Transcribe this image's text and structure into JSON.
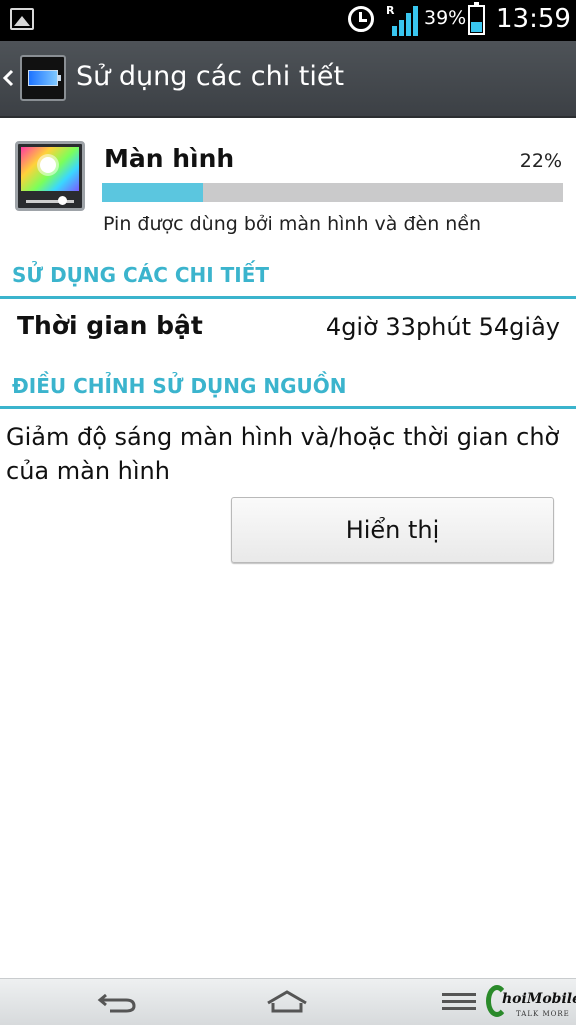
{
  "status_bar": {
    "battery_percent": "39%",
    "time": "13:59",
    "signal_label": "R",
    "battery_level": 0.39,
    "icons": [
      "gallery-icon",
      "alarm-icon",
      "signal-icon",
      "battery-icon"
    ],
    "accent_color": "#39c6ef"
  },
  "action_bar": {
    "title": "Sử dụng các chi tiết",
    "icons": [
      "back-icon",
      "battery-app-icon"
    ]
  },
  "detail": {
    "title": "Màn hình",
    "percent": "22%",
    "usage_fraction": 0.22,
    "description": "Pin được dùng bởi màn hình và đèn nền",
    "icon": "display-brightness-icon",
    "bar_color": "#5bc6df"
  },
  "sections": {
    "usage_details": "SỬ DỤNG CÁC CHI TIẾT",
    "power_adjust": "ĐIỀU CHỈNH SỬ DỤNG NGUỒN",
    "color": "#3bb4cd"
  },
  "uptime": {
    "label": "Thời gian bật",
    "value": "4giờ 33phút 54giây"
  },
  "advice": {
    "text": "Giảm độ sáng màn hình và/hoặc thời gian chờ của màn hình",
    "button_label": "Hiển thị"
  },
  "nav_bar": {
    "icons": [
      "back-icon",
      "home-icon",
      "menu-icon"
    ],
    "watermark": {
      "brand": "hoiMobile",
      "slogan": "TALK MORE"
    }
  }
}
